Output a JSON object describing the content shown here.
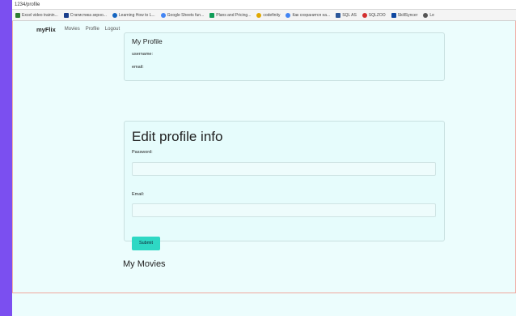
{
  "browser": {
    "url": "1234/profile",
    "bookmarks": [
      {
        "label": "Excel video trainin...",
        "icon": "grid-icon",
        "color": "#2e7d32"
      },
      {
        "label": "Статистика зерно...",
        "icon": "doc-icon",
        "color": "#1a3e8c"
      },
      {
        "label": "Learning How to L...",
        "icon": "globe-icon",
        "color": "#1565c0"
      },
      {
        "label": "Google Sheets fun...",
        "icon": "google-icon",
        "color": "#4285f4"
      },
      {
        "label": "Plans and Pricing...",
        "icon": "sheet-icon",
        "color": "#0f9d58"
      },
      {
        "label": "codefinity",
        "icon": "codefinity-icon",
        "color": "#e0a800"
      },
      {
        "label": "Как сохранится на...",
        "icon": "google-icon",
        "color": "#4285f4"
      },
      {
        "label": "SQL AS",
        "icon": "w-icon",
        "color": "#2a5699"
      },
      {
        "label": "SQLZOO",
        "icon": "zoo-icon",
        "color": "#d32f2f"
      },
      {
        "label": "SkillSyncer",
        "icon": "skillsyncer-icon",
        "color": "#0d47a1"
      },
      {
        "label": "Le",
        "icon": "circle-icon",
        "color": "#555555"
      }
    ]
  },
  "nav": {
    "brand": "myFlix",
    "links": [
      "Movies",
      "Profile",
      "Logout"
    ]
  },
  "profile": {
    "title": "My Profile",
    "username_label": "username:",
    "email_label": "email:"
  },
  "edit": {
    "title": "Edit profile info",
    "password_label": "Password:",
    "email_label": "Email:",
    "submit_label": "Submit"
  },
  "movies": {
    "title": "My Movies"
  }
}
